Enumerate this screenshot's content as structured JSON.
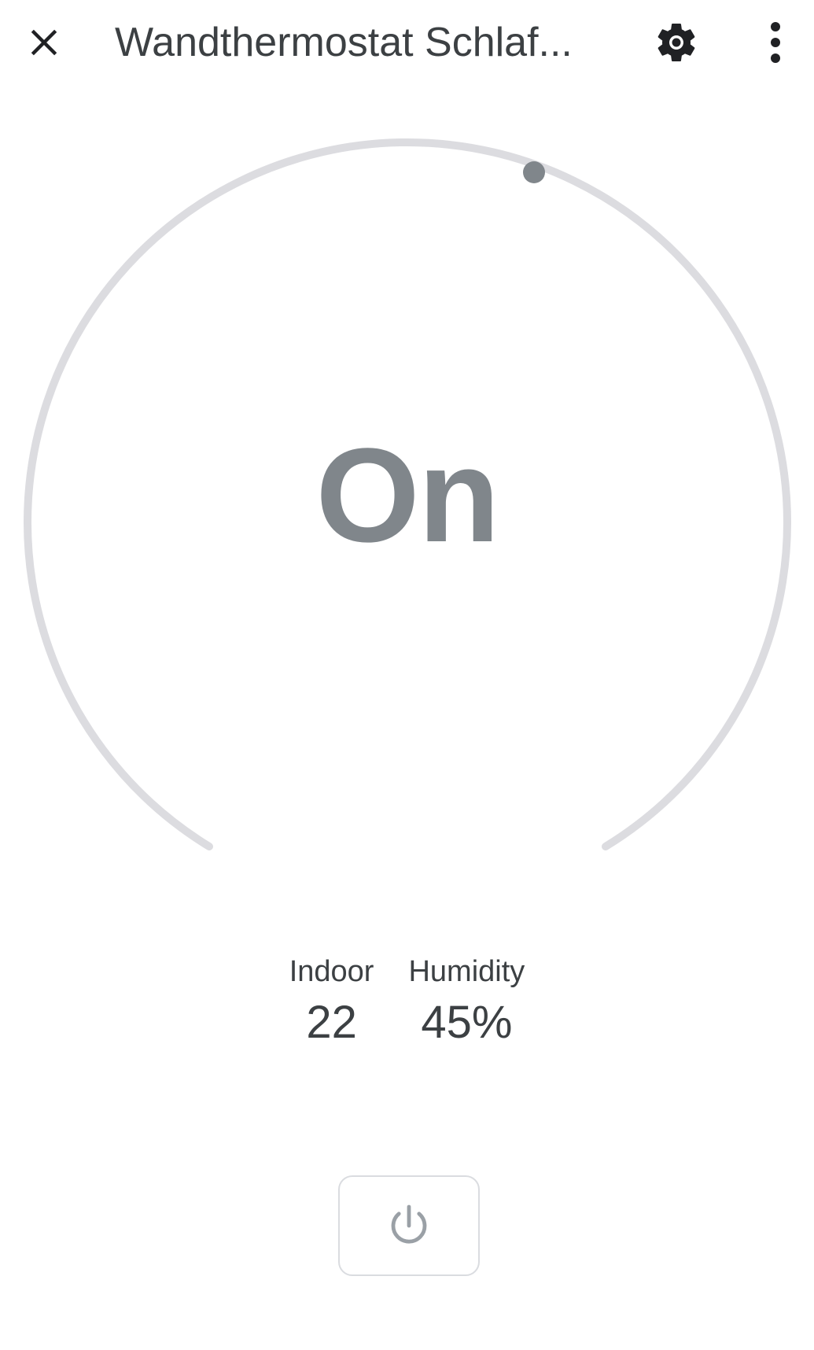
{
  "app_bar": {
    "title": "Wandthermostat Schlaf...",
    "close_icon": "close-icon",
    "settings_icon": "gear-icon",
    "more_icon": "more-vert-icon"
  },
  "dial": {
    "status_text": "On",
    "track_color": "#dcdce0",
    "indicator_color": "#80868b"
  },
  "readings": [
    {
      "label": "Indoor",
      "value": "22"
    },
    {
      "label": "Humidity",
      "value": "45%"
    }
  ],
  "power_button": {
    "icon": "power-icon",
    "border_color": "#dadce0",
    "icon_color": "#9aa0a6"
  }
}
